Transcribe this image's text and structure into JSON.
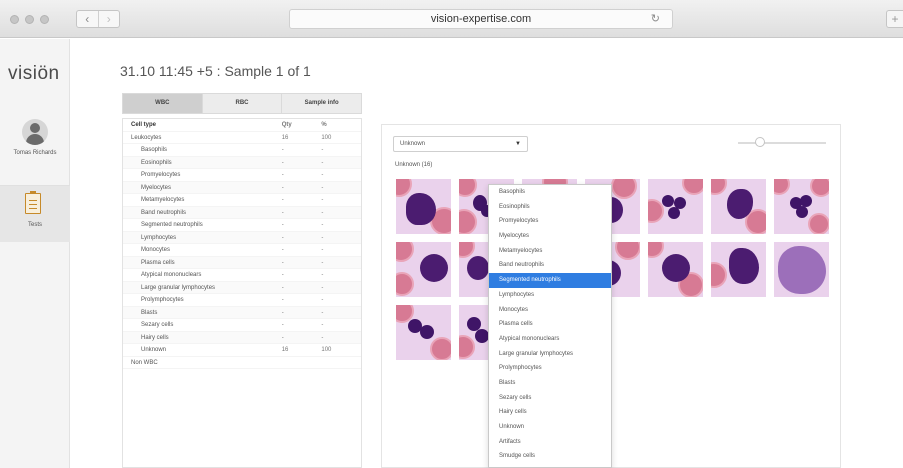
{
  "browser": {
    "url": "vision-expertise.com",
    "back_glyph": "‹",
    "forward_glyph": "›",
    "reload_glyph": "↻",
    "newtab_glyph": "+"
  },
  "rail": {
    "logo": "visiön",
    "user_name": "Tomas Richards",
    "tests_label": "Tests",
    "colors": {
      "tests_icon": "#c68a2a"
    }
  },
  "header": {
    "title": "31.10 11:45 +5 : Sample 1 of 1"
  },
  "tabs": [
    {
      "label": "WBC",
      "active": true
    },
    {
      "label": "RBC",
      "active": false
    },
    {
      "label": "Sample info",
      "active": false
    }
  ],
  "table": {
    "columns": [
      "Cell type",
      "Qty",
      "%"
    ],
    "rows": [
      {
        "cell": "Leukocytes",
        "qty": "16",
        "pct": "100",
        "indent": false
      },
      {
        "cell": "Basophils",
        "qty": "-",
        "pct": "-",
        "indent": true
      },
      {
        "cell": "Eosinophils",
        "qty": "-",
        "pct": "-",
        "indent": true
      },
      {
        "cell": "Promyelocytes",
        "qty": "-",
        "pct": "-",
        "indent": true
      },
      {
        "cell": "Myelocytes",
        "qty": "-",
        "pct": "-",
        "indent": true
      },
      {
        "cell": "Metamyelocytes",
        "qty": "-",
        "pct": "-",
        "indent": true
      },
      {
        "cell": "Band neutrophils",
        "qty": "-",
        "pct": "-",
        "indent": true
      },
      {
        "cell": "Segmented neutrophils",
        "qty": "-",
        "pct": "-",
        "indent": true
      },
      {
        "cell": "Lymphocytes",
        "qty": "-",
        "pct": "-",
        "indent": true
      },
      {
        "cell": "Monocytes",
        "qty": "-",
        "pct": "-",
        "indent": true
      },
      {
        "cell": "Plasma cells",
        "qty": "-",
        "pct": "-",
        "indent": true
      },
      {
        "cell": "Atypical mononuclears",
        "qty": "-",
        "pct": "-",
        "indent": true
      },
      {
        "cell": "Large granular lymphocytes",
        "qty": "-",
        "pct": "-",
        "indent": true
      },
      {
        "cell": "Prolymphocytes",
        "qty": "-",
        "pct": "-",
        "indent": true
      },
      {
        "cell": "Blasts",
        "qty": "-",
        "pct": "-",
        "indent": true
      },
      {
        "cell": "Sezary cells",
        "qty": "-",
        "pct": "-",
        "indent": true
      },
      {
        "cell": "Hairy cells",
        "qty": "-",
        "pct": "-",
        "indent": true
      },
      {
        "cell": "Unknown",
        "qty": "16",
        "pct": "100",
        "indent": true
      },
      {
        "cell": "Non WBC",
        "qty": "",
        "pct": "",
        "indent": false
      }
    ]
  },
  "panel": {
    "filter_value": "Unknown",
    "group_label": "Unknown (16)",
    "slider_value": 0.25
  },
  "dropdown": {
    "items": [
      {
        "label": "Basophils",
        "selected": false
      },
      {
        "label": "Eosinophils",
        "selected": false
      },
      {
        "label": "Promyelocytes",
        "selected": false
      },
      {
        "label": "Myelocytes",
        "selected": false
      },
      {
        "label": "Metamyelocytes",
        "selected": false
      },
      {
        "label": "Band neutrophils",
        "selected": false
      },
      {
        "label": "Segmented neutrophils",
        "selected": true
      },
      {
        "label": "Lymphocytes",
        "selected": false
      },
      {
        "label": "Monocytes",
        "selected": false
      },
      {
        "label": "Plasma cells",
        "selected": false
      },
      {
        "label": "Atypical mononuclears",
        "selected": false
      },
      {
        "label": "Large granular lymphocytes",
        "selected": false
      },
      {
        "label": "Prolymphocytes",
        "selected": false
      },
      {
        "label": "Blasts",
        "selected": false
      },
      {
        "label": "Sezary cells",
        "selected": false
      },
      {
        "label": "Hairy cells",
        "selected": false
      },
      {
        "label": "Unknown",
        "selected": false
      },
      {
        "label": "Artifacts",
        "selected": false
      },
      {
        "label": "Smudge cells",
        "selected": false
      }
    ],
    "colors": {
      "highlight": "#2f7de1"
    }
  }
}
